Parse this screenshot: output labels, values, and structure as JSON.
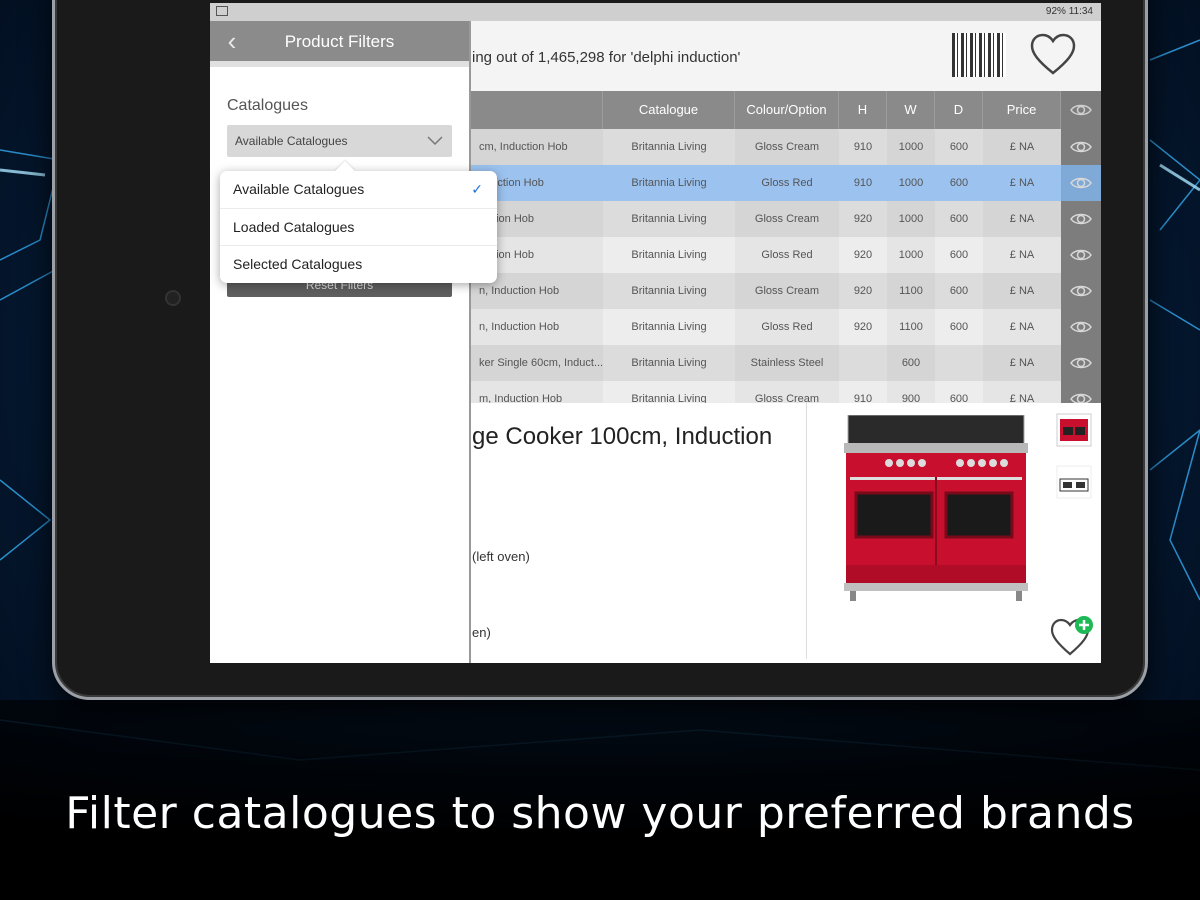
{
  "status": {
    "right_text": "92% 11:34"
  },
  "search": {
    "results_text": "ing out of 1,465,298 for 'delphi induction'"
  },
  "table": {
    "columns": [
      "Catalogue",
      "Colour/Option",
      "H",
      "W",
      "D",
      "Price"
    ],
    "rows": [
      {
        "name": "cm, Induction Hob",
        "catalogue": "Britannia Living",
        "colour": "Gloss Cream",
        "h": "910",
        "w": "1000",
        "d": "600",
        "price": "£ NA"
      },
      {
        "name": "nduction Hob",
        "catalogue": "Britannia Living",
        "colour": "Gloss Red",
        "h": "910",
        "w": "1000",
        "d": "600",
        "price": "£ NA"
      },
      {
        "name": "luction Hob",
        "catalogue": "Britannia Living",
        "colour": "Gloss Cream",
        "h": "920",
        "w": "1000",
        "d": "600",
        "price": "£ NA"
      },
      {
        "name": "luction Hob",
        "catalogue": "Britannia Living",
        "colour": "Gloss Red",
        "h": "920",
        "w": "1000",
        "d": "600",
        "price": "£ NA"
      },
      {
        "name": "n, Induction Hob",
        "catalogue": "Britannia Living",
        "colour": "Gloss Cream",
        "h": "920",
        "w": "1100",
        "d": "600",
        "price": "£ NA"
      },
      {
        "name": "n, Induction Hob",
        "catalogue": "Britannia Living",
        "colour": "Gloss Red",
        "h": "920",
        "w": "1100",
        "d": "600",
        "price": "£ NA"
      },
      {
        "name": "ker Single 60cm, Induct...",
        "catalogue": "Britannia Living",
        "colour": "Stainless Steel",
        "h": "",
        "w": "600",
        "d": "",
        "price": "£ NA"
      },
      {
        "name": "m, Induction Hob",
        "catalogue": "Britannia Living",
        "colour": "Gloss Cream",
        "h": "910",
        "w": "900",
        "d": "600",
        "price": "£ NA"
      }
    ]
  },
  "detail": {
    "title": "ge Cooker 100cm, Induction",
    "line1": "(left oven)",
    "line2": "en)"
  },
  "filter_panel": {
    "title": "Product Filters",
    "catalogues_label": "Catalogues",
    "selected_value": "Available Catalogues",
    "reset_label": "Reset Filters",
    "options": [
      {
        "label": "Available Catalogues",
        "checked": true
      },
      {
        "label": "Loaded Catalogues",
        "checked": false
      },
      {
        "label": "Selected Catalogues",
        "checked": false
      }
    ],
    "check_glyph": "✓"
  },
  "caption": "Filter catalogues to show your preferred brands",
  "colors": {
    "selected_row": "#9cc3f0",
    "header_gray": "#8a8a8a",
    "check_blue": "#1e6fd9",
    "cooker_red": "#c8102e",
    "add_green": "#1db954"
  }
}
